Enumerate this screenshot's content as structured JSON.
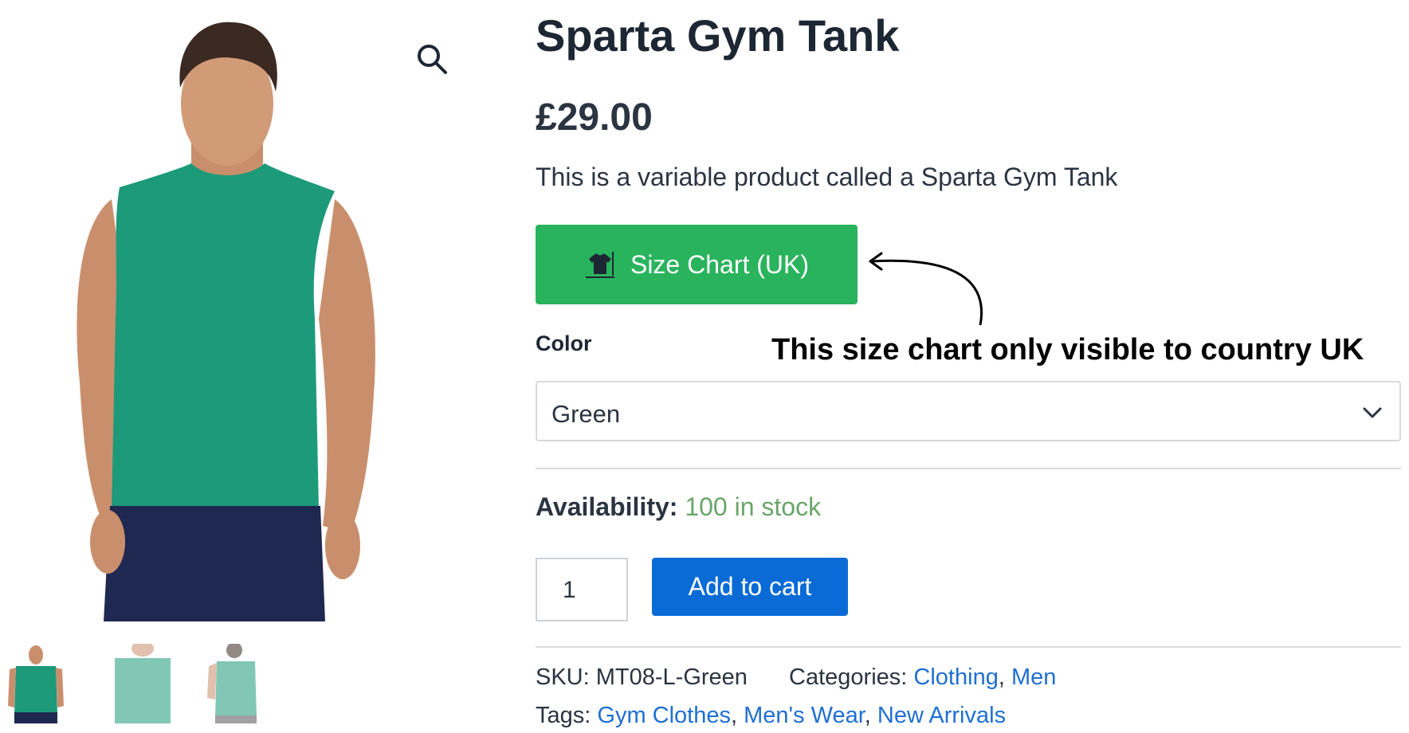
{
  "product": {
    "title": "Sparta Gym Tank",
    "price": "£29.00",
    "description": "This is a variable product called a Sparta Gym Tank"
  },
  "size_chart": {
    "button_label": "Size Chart (UK)",
    "annotation": "This size chart only visible to country UK",
    "button_color": "#2ab35d"
  },
  "variation": {
    "label": "Color",
    "selected": "Green"
  },
  "availability": {
    "label": "Availability:",
    "value": "100 in stock",
    "value_color": "#6aa56a"
  },
  "cart": {
    "quantity": "1",
    "add_label": "Add to cart",
    "button_color": "#0a6bd6"
  },
  "meta": {
    "sku_label": "SKU:",
    "sku": "MT08-L-Green",
    "categories_label": "Categories:",
    "categories": [
      "Clothing",
      "Men"
    ],
    "tags_label": "Tags:",
    "tags": [
      "Gym Clothes",
      "Men's Wear",
      "New Arrivals"
    ],
    "separator": ","
  },
  "icons": {
    "zoom": "magnifier-icon",
    "size_chart": "tshirt-icon",
    "dropdown": "chevron-down-icon"
  }
}
